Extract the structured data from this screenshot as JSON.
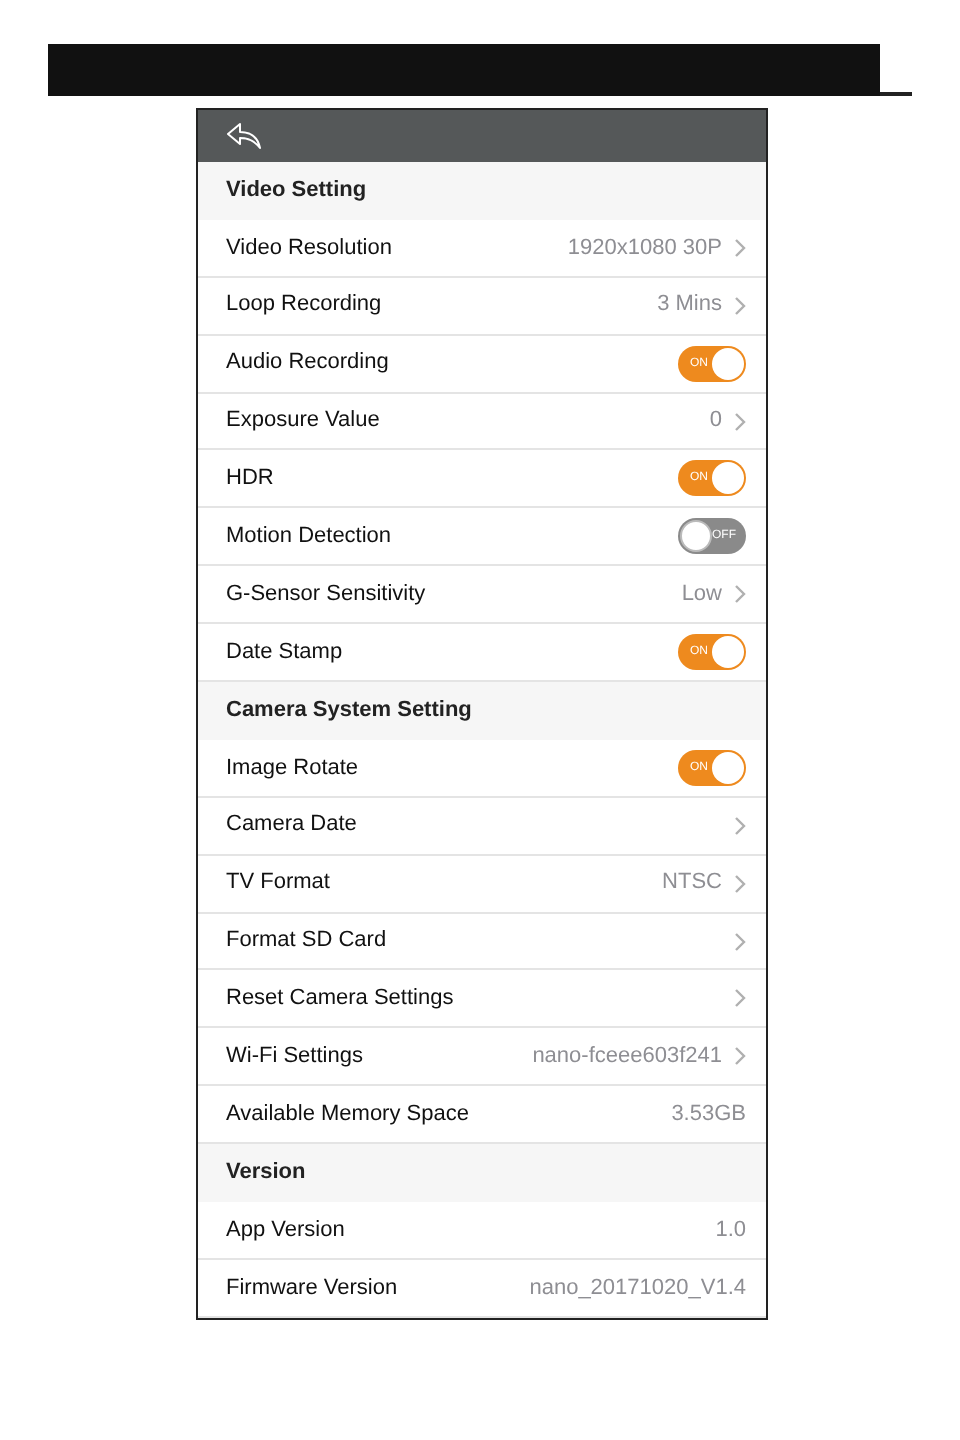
{
  "sections": [
    {
      "title": "Video Setting",
      "items": [
        {
          "kind": "link",
          "label": "Video Resolution",
          "value": "1920x1080 30P"
        },
        {
          "kind": "link",
          "label": "Loop Recording",
          "value": "3 Mins"
        },
        {
          "kind": "toggle",
          "label": "Audio Recording",
          "on": true,
          "switch_label": "ON"
        },
        {
          "kind": "link",
          "label": "Exposure Value",
          "value": "0"
        },
        {
          "kind": "toggle",
          "label": "HDR",
          "on": true,
          "switch_label": "ON"
        },
        {
          "kind": "toggle",
          "label": "Motion Detection",
          "on": false,
          "switch_label": "OFF"
        },
        {
          "kind": "link",
          "label": "G-Sensor Sensitivity",
          "value": "Low"
        },
        {
          "kind": "toggle",
          "label": "Date Stamp",
          "on": true,
          "switch_label": "ON"
        }
      ]
    },
    {
      "title": "Camera System Setting",
      "items": [
        {
          "kind": "toggle",
          "label": "Image Rotate",
          "on": true,
          "switch_label": "ON"
        },
        {
          "kind": "link",
          "label": "Camera Date"
        },
        {
          "kind": "link",
          "label": "TV Format",
          "value": "NTSC"
        },
        {
          "kind": "link",
          "label": "Format SD Card"
        },
        {
          "kind": "link",
          "label": "Reset Camera Settings"
        },
        {
          "kind": "link",
          "label": "Wi-Fi Settings",
          "value": "nano-fceee603f241"
        },
        {
          "kind": "value",
          "label": "Available Memory Space",
          "value": "3.53GB"
        }
      ]
    },
    {
      "title": "Version",
      "items": [
        {
          "kind": "value",
          "label": "App Version",
          "value": "1.0"
        },
        {
          "kind": "value",
          "label": "Firmware Version",
          "value": "nano_20171020_V1.4"
        }
      ]
    }
  ]
}
